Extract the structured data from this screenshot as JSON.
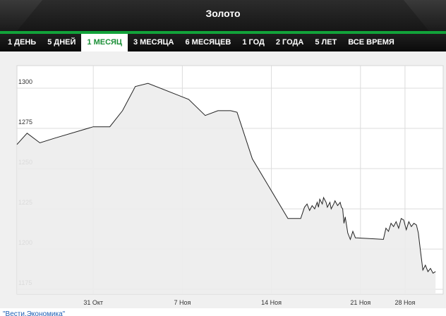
{
  "header": {
    "title": "Золото"
  },
  "tabs": [
    {
      "label": "1 ДЕНЬ",
      "active": false
    },
    {
      "label": "5 ДНЕЙ",
      "active": false
    },
    {
      "label": "1 МЕСЯЦ",
      "active": true
    },
    {
      "label": "3 МЕСЯЦА",
      "active": false
    },
    {
      "label": "6 МЕСЯЦЕВ",
      "active": false
    },
    {
      "label": "1 ГОД",
      "active": false
    },
    {
      "label": "2 ГОДА",
      "active": false
    },
    {
      "label": "5 ЛЕТ",
      "active": false
    },
    {
      "label": "ВСЕ ВРЕМЯ",
      "active": false
    }
  ],
  "colors": {
    "accent_green": "#12a33a",
    "active_tab_text": "#1a8f36",
    "line": "#222222",
    "fill": "#ececec"
  },
  "source_link": "\"Вести.Экономика\"",
  "chart_data": {
    "type": "area",
    "grid": true,
    "ylim": [
      1172,
      1314
    ],
    "xlim": [
      0,
      33.5
    ],
    "yticks": [
      1175,
      1200,
      1225,
      1250,
      1275,
      1300
    ],
    "xticks": [
      {
        "label": "31 Окт",
        "x": 6
      },
      {
        "label": "7 Ноя",
        "x": 13
      },
      {
        "label": "14 Ноя",
        "x": 20
      },
      {
        "label": "21 Ноя",
        "x": 27
      },
      {
        "label": "28 Ноя",
        "x": 30.5
      }
    ],
    "series": [
      {
        "points": [
          [
            0,
            1265
          ],
          [
            0.8,
            1272
          ],
          [
            1.8,
            1266
          ],
          [
            3,
            1269
          ],
          [
            6,
            1276
          ],
          [
            7.3,
            1276
          ],
          [
            8.3,
            1286
          ],
          [
            9.3,
            1301
          ],
          [
            10.3,
            1303
          ],
          [
            13.5,
            1293
          ],
          [
            14.8,
            1283
          ],
          [
            15.8,
            1286
          ],
          [
            16.8,
            1286
          ],
          [
            17.3,
            1285
          ],
          [
            18.5,
            1256
          ],
          [
            21.3,
            1219
          ],
          [
            22.3,
            1219
          ],
          [
            22.6,
            1226
          ],
          [
            22.8,
            1228
          ],
          [
            23.0,
            1224
          ],
          [
            23.2,
            1227
          ],
          [
            23.4,
            1225
          ],
          [
            23.6,
            1229
          ],
          [
            23.7,
            1226
          ],
          [
            23.8,
            1231
          ],
          [
            24.0,
            1228
          ],
          [
            24.1,
            1232
          ],
          [
            24.3,
            1229
          ],
          [
            24.4,
            1226
          ],
          [
            24.6,
            1229
          ],
          [
            24.7,
            1225
          ],
          [
            24.9,
            1228
          ],
          [
            25.0,
            1230
          ],
          [
            25.2,
            1227
          ],
          [
            25.4,
            1229
          ],
          [
            25.5,
            1226
          ],
          [
            25.6,
            1225
          ],
          [
            25.7,
            1216
          ],
          [
            25.8,
            1220
          ],
          [
            26.0,
            1210
          ],
          [
            26.2,
            1206
          ],
          [
            26.4,
            1211
          ],
          [
            26.6,
            1207
          ],
          [
            28.8,
            1206
          ],
          [
            29.0,
            1213
          ],
          [
            29.2,
            1211
          ],
          [
            29.4,
            1216
          ],
          [
            29.6,
            1214
          ],
          [
            29.8,
            1217
          ],
          [
            30.0,
            1213
          ],
          [
            30.2,
            1219
          ],
          [
            30.4,
            1218
          ],
          [
            30.6,
            1212
          ],
          [
            30.8,
            1217
          ],
          [
            31.0,
            1214
          ],
          [
            31.2,
            1216
          ],
          [
            31.4,
            1215
          ],
          [
            31.55,
            1210
          ],
          [
            31.7,
            1200
          ],
          [
            31.9,
            1187
          ],
          [
            32.1,
            1190
          ],
          [
            32.3,
            1186
          ],
          [
            32.5,
            1188
          ],
          [
            32.7,
            1185
          ],
          [
            32.9,
            1186
          ]
        ]
      }
    ]
  }
}
